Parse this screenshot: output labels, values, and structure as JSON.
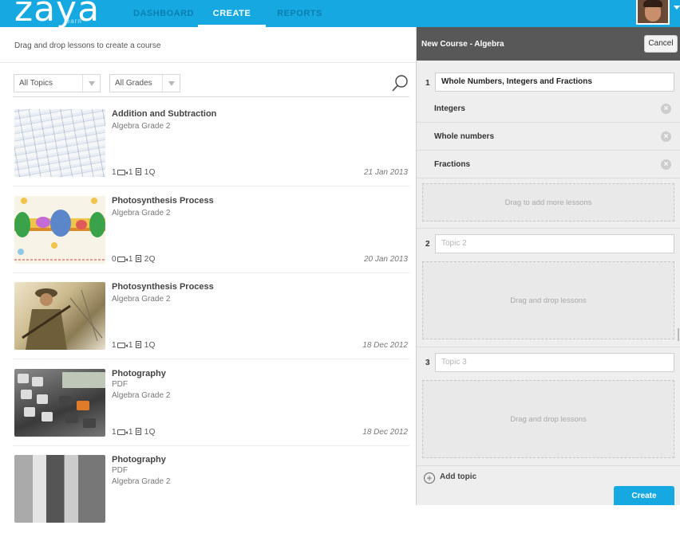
{
  "header": {
    "logo": "zaya",
    "logo_sub": "learn",
    "nav": [
      {
        "label": "DASHBOARD",
        "active": false
      },
      {
        "label": "CREATE",
        "active": true
      },
      {
        "label": "REPORTS",
        "active": false
      }
    ],
    "brand_color": "#16a9e1"
  },
  "library": {
    "instructions": "Drag and drop lessons to create a course",
    "filters": {
      "topics": "All Topics",
      "grades": "All Grades"
    },
    "lessons": [
      {
        "title": "Addition and Subtraction",
        "type": "",
        "meta": "Algebra  Grade 2",
        "videos": "1",
        "docs": "1",
        "questions": "1Q",
        "date": "21 Jan 2013"
      },
      {
        "title": "Photosynthesis Process",
        "type": "",
        "meta": "Algebra  Grade 2",
        "videos": "0",
        "docs": "1",
        "questions": "2Q",
        "date": "20 Jan 2013"
      },
      {
        "title": "Photosynthesis Process",
        "type": "",
        "meta": "Algebra  Grade 2",
        "videos": "1",
        "docs": "1",
        "questions": "1Q",
        "date": "18 Dec 2012"
      },
      {
        "title": "Photography",
        "type": "PDF",
        "meta": "Algebra  Grade 2",
        "videos": "1",
        "docs": "1",
        "questions": "1Q",
        "date": "18 Dec 2012"
      },
      {
        "title": "Photography",
        "type": "PDF",
        "meta": "Algebra  Grade 2",
        "videos": "",
        "docs": "",
        "questions": "",
        "date": ""
      }
    ]
  },
  "course": {
    "title": "New Course - Algebra",
    "cancel_label": "Cancel",
    "topics": [
      {
        "number": "1",
        "value": "Whole Numbers, Integers and Fractions",
        "placeholder": "",
        "lessons": [
          "Integers",
          "Whole numbers",
          "Fractions"
        ],
        "dropzone": "Drag to add more lessons"
      },
      {
        "number": "2",
        "value": "",
        "placeholder": "Topic 2",
        "lessons": [],
        "dropzone": "Drag and drop lessons"
      },
      {
        "number": "3",
        "value": "",
        "placeholder": "Topic 3",
        "lessons": [],
        "dropzone": "Drag and drop lessons"
      }
    ],
    "add_topic_label": "Add topic",
    "create_label": "Create"
  }
}
